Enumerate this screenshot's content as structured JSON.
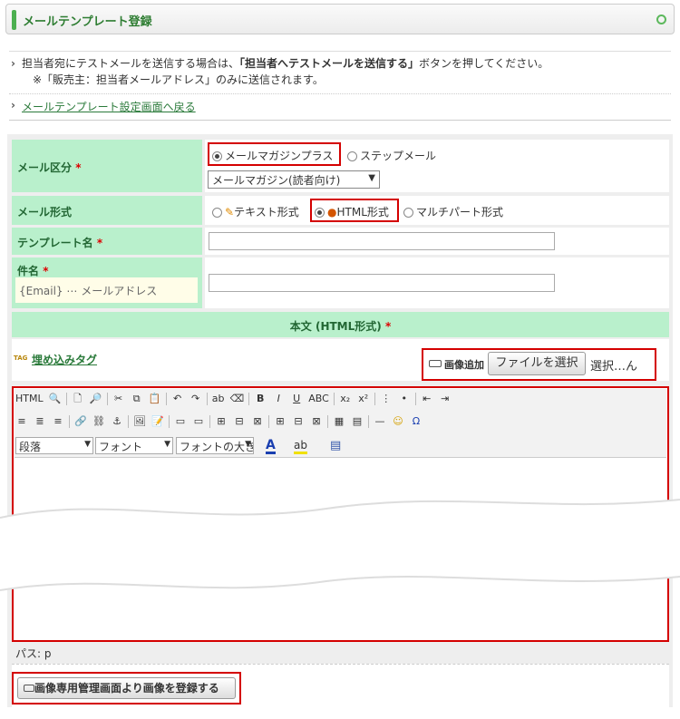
{
  "header": {
    "title": "メールテンプレート登録"
  },
  "info": {
    "line1_pre": "担当者宛にテストメールを送信する場合は、",
    "line1_bold": "「担当者へテストメールを送信する」",
    "line1_post": "ボタンを押してください。",
    "line2": "※「販売主：担当者メールアドレス」のみに送信されます。",
    "back_link": "メールテンプレート設定画面へ戻る"
  },
  "form": {
    "mail_type_label": "メール区分",
    "required_mark": "*",
    "mail_type_options": [
      "メールマガジンプラス",
      "ステップメール"
    ],
    "mail_type_selected": "メールマガジン(読者向け)",
    "format_label": "メール形式",
    "format_options": [
      "テキスト形式",
      "HTML形式",
      "マルチパート形式"
    ],
    "template_name_label": "テンプレート名",
    "subject_label": "件名",
    "subject_hint": "{Email} ⋯ メールアドレス",
    "body_label": "本文 (HTML形式)",
    "embed_tag_link": "埋め込みタグ",
    "tag_badge": "TAG",
    "image_add_label": "画像追加",
    "file_button": "ファイルを選択",
    "file_status": "選択…ん",
    "combo_paragraph": "段落",
    "combo_font": "フォント",
    "combo_size": "フォントの大きさ",
    "path_label": "パス: p",
    "register_image_button": "画像専用管理画面より画像を登録する"
  },
  "toolbar": {
    "row1": [
      "HTML",
      "🔍",
      "│",
      "🗋",
      "🔎",
      "│",
      "✂",
      "⧉",
      "📋",
      "│",
      "↶",
      "↷",
      "│",
      "ab",
      "⌫",
      "│",
      "B",
      "I",
      "U",
      "ABC",
      "│",
      "x₂",
      "x²",
      "│",
      "⋮",
      "•",
      "│",
      "⇤",
      "⇥"
    ],
    "row2": [
      "≡",
      "≣",
      "≡",
      "│",
      "🔗",
      "⛓",
      "⚓",
      "│",
      "🖼",
      "📝",
      "│",
      "▭",
      "▭",
      "│",
      "⊞",
      "⊟",
      "⊠",
      "│",
      "⊞",
      "⊟",
      "⊠",
      "│",
      "▦",
      "▤",
      "│",
      "—",
      "☺",
      "Ω"
    ],
    "row3_icons": [
      "A",
      "ab",
      "▤"
    ]
  },
  "colors": {
    "accent_green": "#4caf50",
    "label_bg": "#b9f0cc",
    "highlight_red": "#d40000"
  }
}
